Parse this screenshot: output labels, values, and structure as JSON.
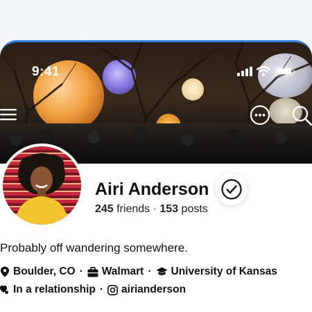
{
  "status_bar": {
    "time": "9:41"
  },
  "profile": {
    "name": "Airi Anderson",
    "friends_count": "245",
    "friends_label": " friends · ",
    "posts_count": "153",
    "posts_label": " posts",
    "bio": "Probably off wandering somewhere.",
    "location": "Boulder, CO",
    "work": "Walmart",
    "education": "University of Kansas",
    "relationship": "In a relationship",
    "instagram": "airianderson"
  },
  "icons": {
    "menu": "menu-icon",
    "more": "more-icon",
    "search": "search-icon",
    "verified": "verified-icon",
    "location": "location-pin-icon",
    "work": "briefcase-icon",
    "education": "graduation-cap-icon",
    "relationship": "hearts-icon",
    "instagram": "instagram-icon"
  },
  "colors": {
    "accent_border": "#2f7fe0"
  }
}
